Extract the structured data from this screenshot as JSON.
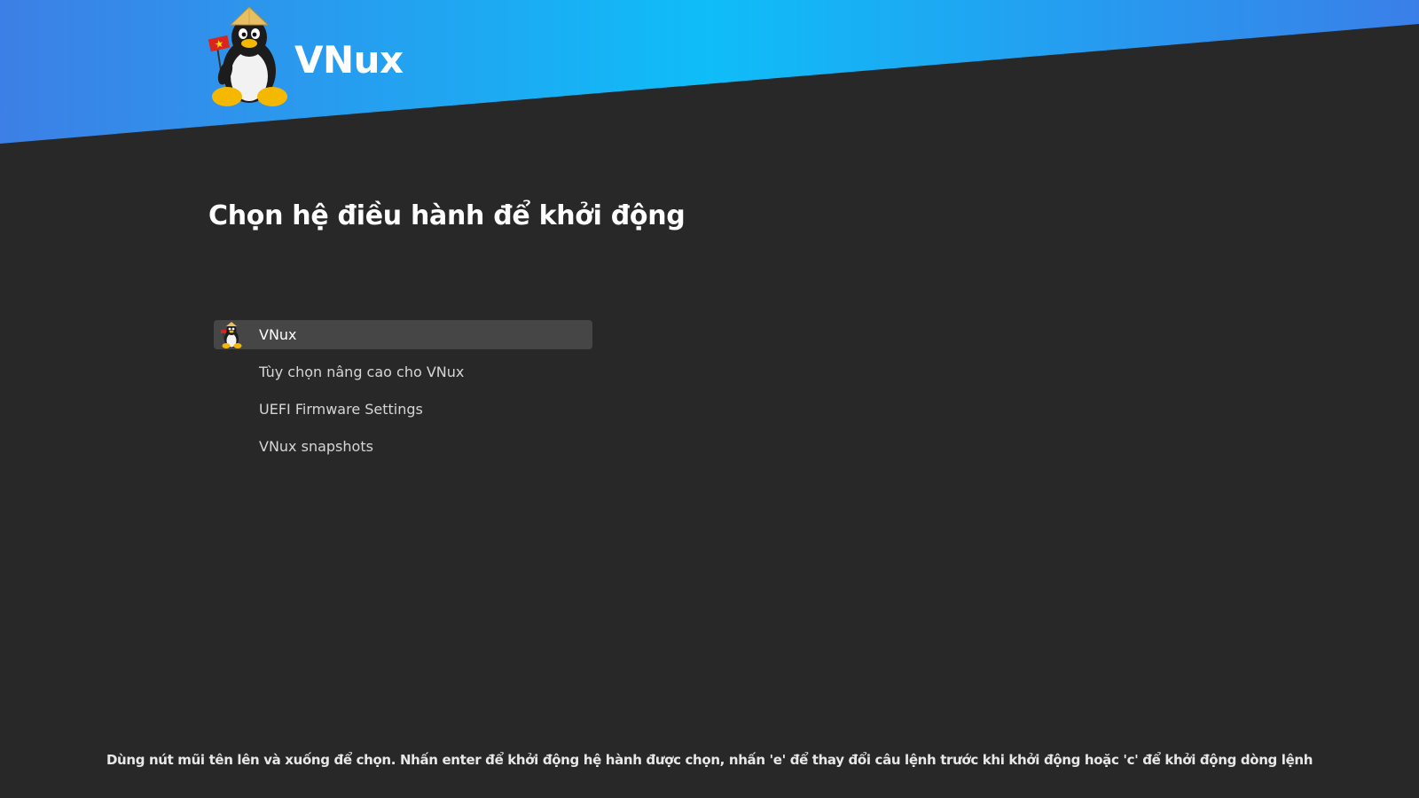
{
  "banner": {
    "brand_name": "VNux",
    "gradient_left": "#3d7fe6",
    "gradient_mid": "#0fbdf8",
    "gradient_right": "#3a7fe8"
  },
  "heading": "Chọn hệ điều hành để khởi động",
  "menu": {
    "items": [
      {
        "label": "VNux",
        "selected": true,
        "icon": "tux-penguin-icon"
      },
      {
        "label": "Tùy chọn nâng cao cho VNux",
        "selected": false
      },
      {
        "label": "UEFI Firmware Settings",
        "selected": false
      },
      {
        "label": "VNux snapshots",
        "selected": false
      }
    ]
  },
  "footer": {
    "help_text": "Dùng nút mũi tên lên và xuống để chọn. Nhấn enter để khởi động hệ hành được chọn, nhấn 'e' để thay đổi câu lệnh trước khi khởi động hoặc 'c' để khởi động dòng lệnh"
  },
  "colors": {
    "background": "#282828",
    "selected_row": "#464646",
    "text": "#ffffff"
  }
}
